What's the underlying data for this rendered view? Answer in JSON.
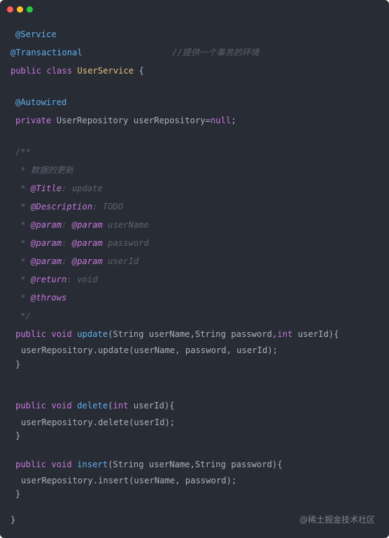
{
  "window": {
    "controls": [
      "close",
      "minimize",
      "maximize"
    ]
  },
  "code": {
    "ann_service": "@Service",
    "ann_transactional": "@Transactional",
    "comment_tx": "//提供一个事务的环境",
    "kw_public_class": "public class ",
    "class_name": "UserService",
    "brace_open_class": " {",
    "ann_autowired": "@Autowired",
    "kw_private": "private ",
    "field_decl": "UserRepository userRepository=",
    "kw_null": "null",
    "semicolon": ";",
    "doc_open": "/**",
    "doc_desc": " * 数据的更新",
    "doc_star": " * ",
    "tag_title": "@Title",
    "title_val": ": update",
    "tag_description": "@Description",
    "description_val": ": TODO",
    "tag_param": "@param",
    "param_sep": ": ",
    "param_username": " userName",
    "param_password": " password",
    "param_userid": " userId",
    "tag_return": "@return",
    "return_val": ": void",
    "tag_throws": "@throws",
    "doc_close": " */",
    "kw_public_void": "public void ",
    "fn_update": "update",
    "update_params_a": "(String userName,String password,",
    "kw_int": "int",
    "update_params_b": " userId){",
    "update_body": "userRepository.update(userName, password, userId);",
    "brace_close": "}",
    "fn_delete": "delete",
    "paren_open": "(",
    "delete_params_b": " userId){",
    "delete_body": "userRepository.delete(userId);",
    "fn_insert": "insert",
    "insert_params": "(String userName,String password){",
    "insert_body": "userRepository.insert(userName, password);",
    "class_close": "}"
  },
  "watermark": "@稀土掘金技术社区",
  "colors": {
    "background": "#282c34",
    "annotation": "#61afef",
    "keyword": "#c678dd",
    "class_name": "#e5c07b",
    "function": "#61afef",
    "comment": "#5c6370",
    "text": "#abb2bf"
  }
}
